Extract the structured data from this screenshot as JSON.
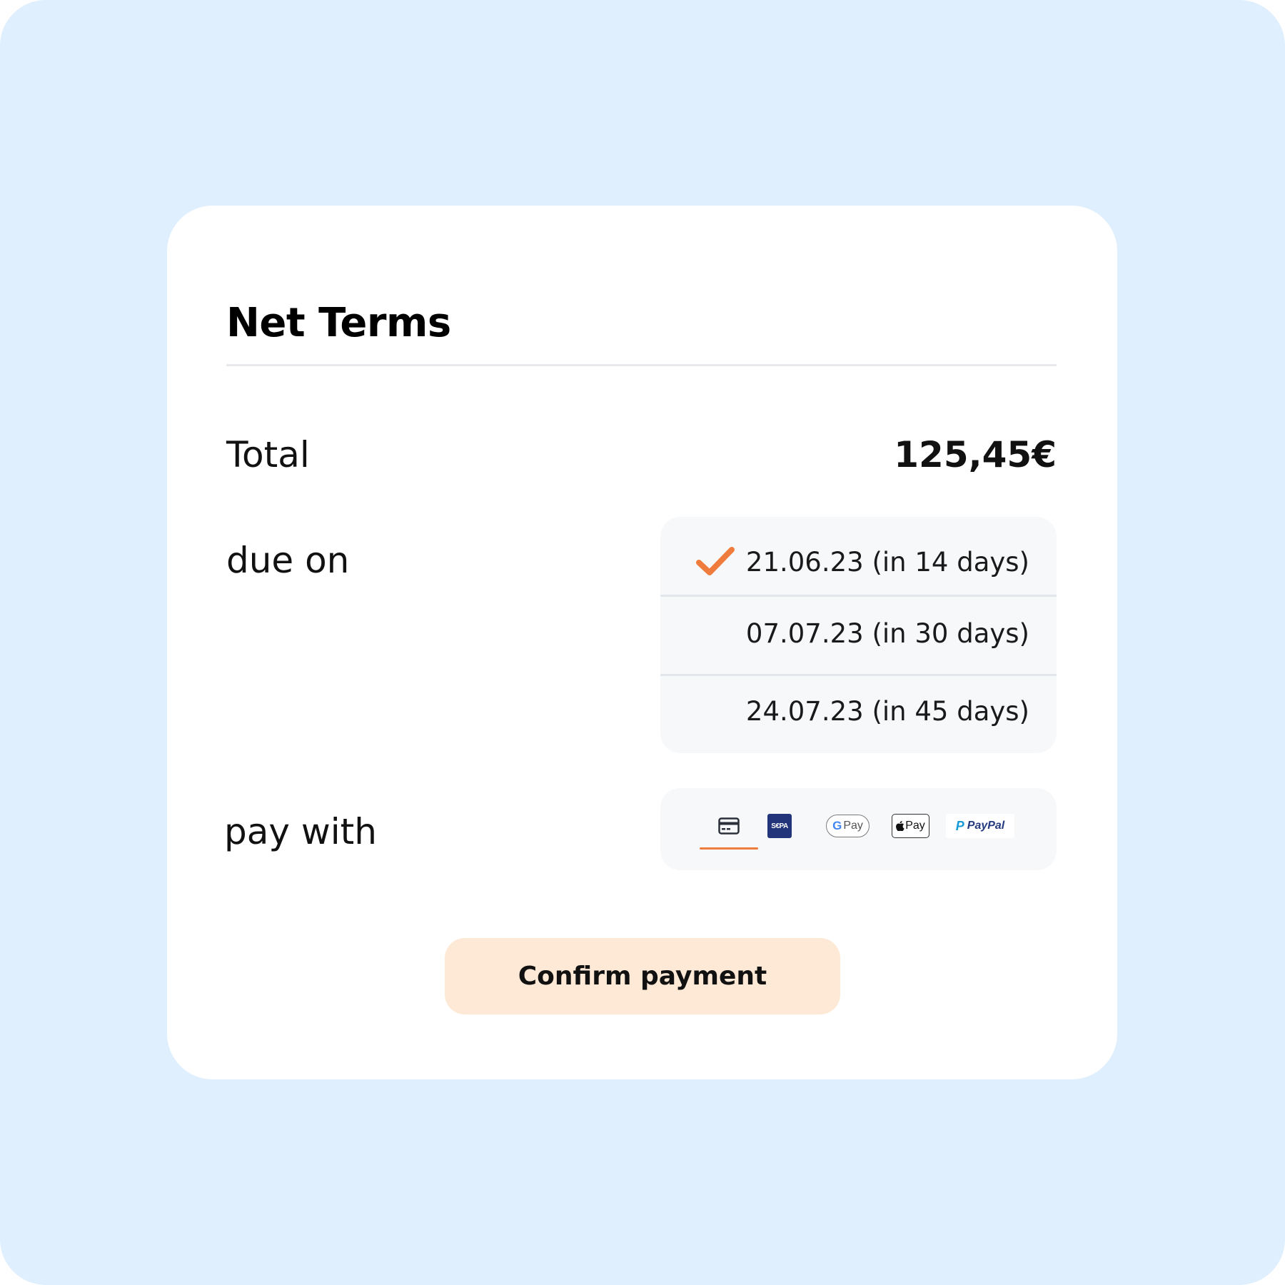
{
  "card": {
    "title": "Net Terms"
  },
  "total": {
    "label": "Total",
    "value": "125,45€"
  },
  "due": {
    "label": "due on",
    "options": [
      {
        "label": "21.06.23 (in 14 days)",
        "selected": true
      },
      {
        "label": "07.07.23 (in 30 days)",
        "selected": false
      },
      {
        "label": "24.07.23 (in 45 days)",
        "selected": false
      }
    ]
  },
  "pay": {
    "label": "pay with",
    "methods": [
      {
        "name": "card",
        "icon": "credit-card-icon",
        "selected": true
      },
      {
        "name": "sepa",
        "icon": "sepa-icon",
        "text": "S€PA",
        "selected": false
      },
      {
        "name": "google-pay",
        "icon": "google-pay-icon",
        "g": "G",
        "text": "Pay",
        "selected": false
      },
      {
        "name": "apple-pay",
        "icon": "apple-pay-icon",
        "apple": "",
        "text": "Pay",
        "selected": false
      },
      {
        "name": "paypal",
        "icon": "paypal-icon",
        "p": "P",
        "text": "PayPal",
        "selected": false
      }
    ]
  },
  "actions": {
    "confirm_label": "Confirm payment"
  },
  "colors": {
    "background": "#e0effd",
    "card": "#ffffff",
    "accent": "#ef7c3c",
    "button": "#fde9d6",
    "panel": "#f6f8fa"
  }
}
